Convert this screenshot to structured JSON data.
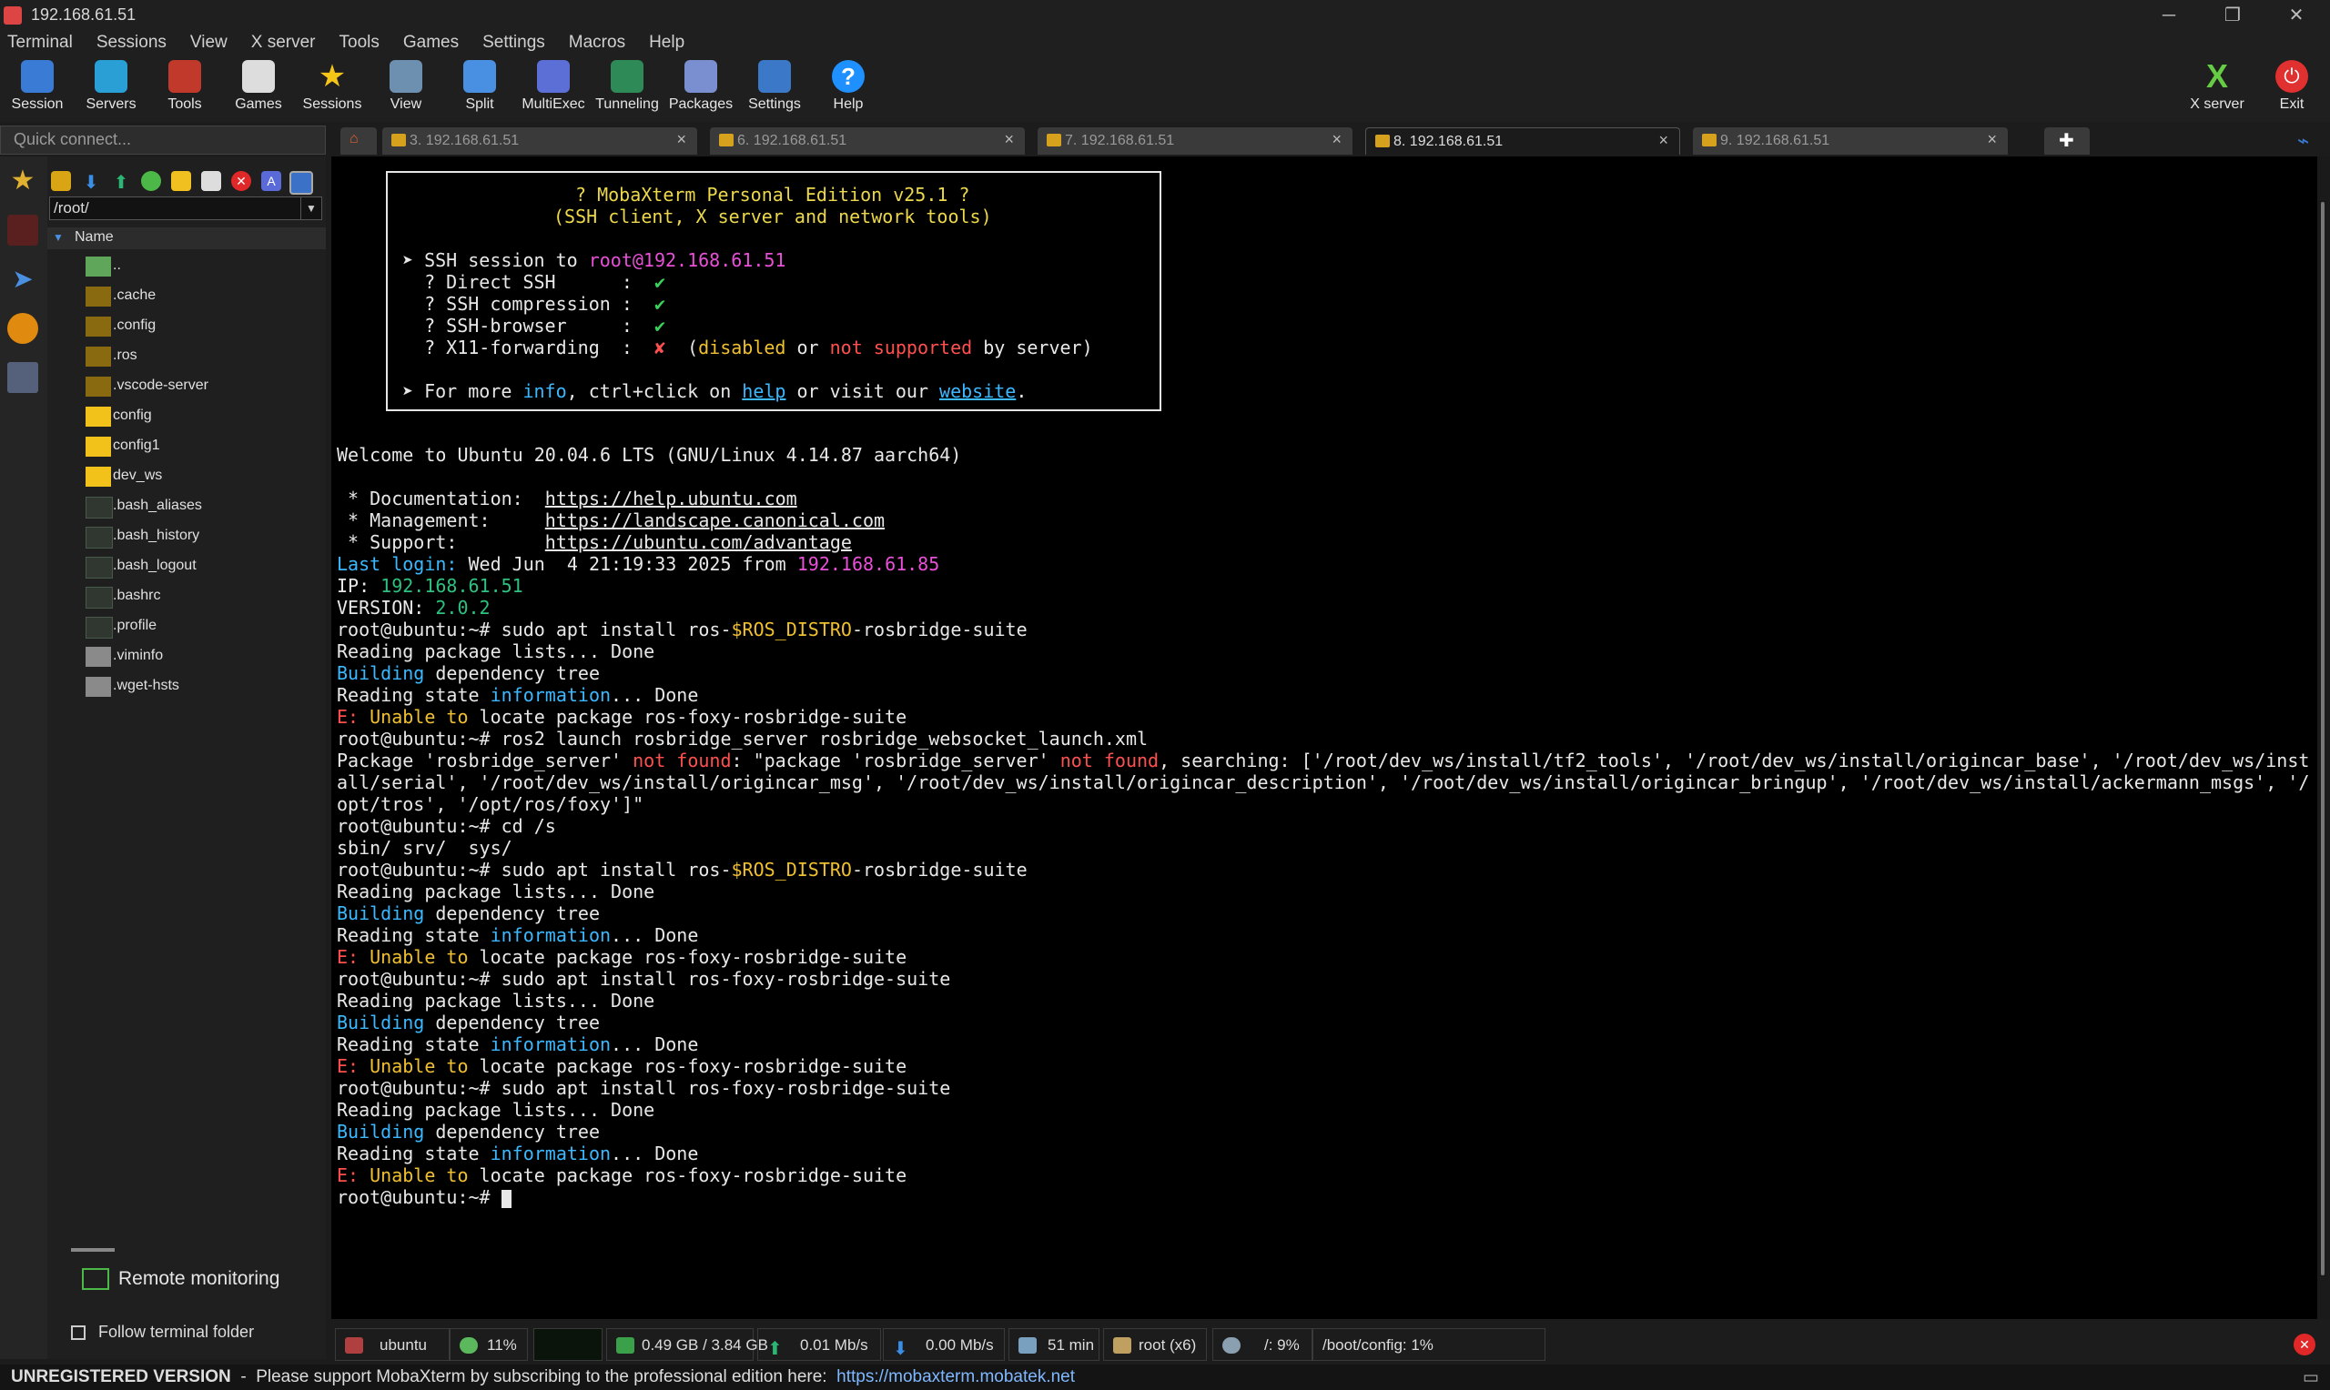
{
  "window": {
    "title": "192.168.61.51"
  },
  "menu": [
    "Terminal",
    "Sessions",
    "View",
    "X server",
    "Tools",
    "Games",
    "Settings",
    "Macros",
    "Help"
  ],
  "toolbar": {
    "items": [
      "Session",
      "Servers",
      "Tools",
      "Games",
      "Sessions",
      "View",
      "Split",
      "MultiExec",
      "Tunneling",
      "Packages",
      "Settings",
      "Help"
    ],
    "right": [
      "X server",
      "Exit"
    ]
  },
  "quick_connect": {
    "placeholder": "Quick connect..."
  },
  "tabs": [
    "3. 192.168.61.51",
    "6. 192.168.61.51",
    "7. 192.168.61.51",
    "8. 192.168.61.51",
    "9. 192.168.61.51"
  ],
  "sidebar": {
    "path": "/root/",
    "header": "Name",
    "files": [
      "..",
      ".cache",
      ".config",
      ".ros",
      ".vscode-server",
      "config",
      "config1",
      "dev_ws",
      ".bash_aliases",
      ".bash_history",
      ".bash_logout",
      ".bashrc",
      ".profile",
      ".viminfo",
      ".wget-hsts"
    ],
    "remote_monitoring": "Remote monitoring",
    "follow_label": "Follow terminal folder"
  },
  "banner": {
    "title": "? MobaXterm Personal Edition v25.1 ?",
    "subtitle": "(SSH client, X server and network tools)",
    "ssh_line_prefix": "➤ SSH session to ",
    "ssh_target": "root@192.168.61.51",
    "rows": [
      {
        "label": "  ? Direct SSH      :  ",
        "mark": "✔"
      },
      {
        "label": "  ? SSH compression :  ",
        "mark": "✔"
      },
      {
        "label": "  ? SSH-browser     :  ",
        "mark": "✔"
      },
      {
        "label": "  ? X11-forwarding  :  ",
        "mark": "✘"
      }
    ],
    "x11_suffix": [
      "  (",
      "disabled",
      " or ",
      "not supported",
      " by server)"
    ],
    "more": [
      "➤ For more ",
      "info",
      ", ctrl+click on ",
      "help",
      " or visit our ",
      "website",
      "."
    ]
  },
  "terminal": {
    "welcome": "Welcome to Ubuntu 20.04.6 LTS (GNU/Linux 4.14.87 aarch64)",
    "doc_label": " * Documentation:  ",
    "doc_url": "https://help.ubuntu.com",
    "mgmt_label": " * Management:     ",
    "mgmt_url": "https://landscape.canonical.com",
    "sup_label": " * Support:        ",
    "sup_url": "https://ubuntu.com/advantage",
    "last_login_label": "Last login:",
    "last_login_text": " Wed Jun  4 21:19:33 2025 from ",
    "last_login_ip": "192.168.61.85",
    "ip_label": "IP: ",
    "ip_value": "192.168.61.51",
    "ver_label": "VERSION: ",
    "ver_value": "2.0.2",
    "prompt": "root@ubuntu:~# ",
    "cmd1a": "sudo apt install ros-",
    "cmd1var": "$ROS_DISTRO",
    "cmd1b": "-rosbridge-suite",
    "reading": "Reading package lists... Done",
    "building": "Building",
    "dep_tree": " dependency tree",
    "state_a": "Reading state ",
    "state_info": "information",
    "state_b": "... Done",
    "err_e": "E: ",
    "err_unable": "Unable to",
    "err_rest": " locate package ros-foxy-rosbridge-suite",
    "cmd2": "ros2 launch rosbridge_server rosbridge_websocket_launch.xml",
    "pkg_a": "Package 'rosbridge_server' ",
    "not_found": "not found",
    "pkg_b": ": \"package 'rosbridge_server' ",
    "pkg_c": ", searching: ['/root/dev_ws/install/tf2_tools', '/root/dev_ws/install/origincar_base', '/root/dev_ws/inst",
    "pkg_line2": "all/serial', '/root/dev_ws/install/origincar_msg', '/root/dev_ws/install/origincar_description', '/root/dev_ws/install/origincar_bringup', '/root/dev_ws/install/ackermann_msgs', '/",
    "pkg_line3": "opt/tros', '/opt/ros/foxy']\"",
    "cmd3": "cd /s",
    "ls_out": "sbin/ srv/  sys/",
    "cmd4": "sudo apt install ros-foxy-rosbridge-suite"
  },
  "status": {
    "host": "ubuntu",
    "cpu": "11%",
    "mem": "0.49 GB / 3.84 GB",
    "up": "0.01 Mb/s",
    "down": "0.00 Mb/s",
    "uptime": "51 min",
    "user": "root (x6)",
    "disk_root": "/: 9%",
    "disk_boot": "/boot/config: 1%"
  },
  "footer": {
    "unregistered": "UNREGISTERED VERSION",
    "text": "  -  Please support MobaXterm by subscribing to the professional edition here:  ",
    "url": "https://mobaxterm.mobatek.net"
  }
}
